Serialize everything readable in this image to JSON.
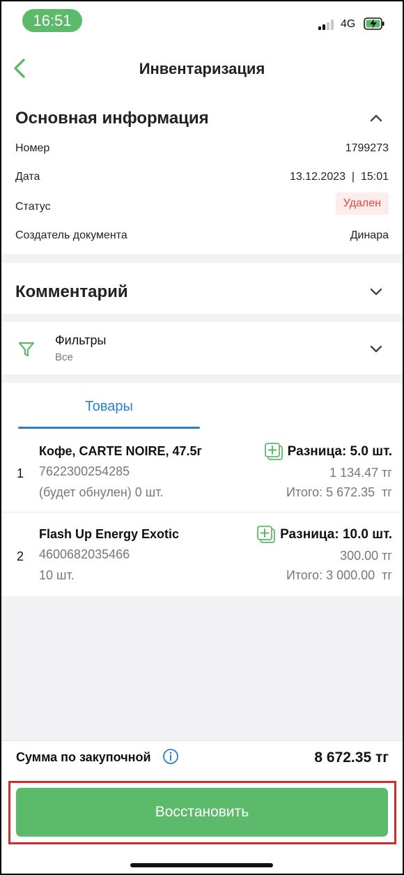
{
  "status_bar": {
    "time": "16:51",
    "network": "4G"
  },
  "nav": {
    "back_icon": "chevron-left-icon",
    "title": "Инвентаризация"
  },
  "main_info": {
    "title": "Основная информация",
    "collapse_icon": "chevron-up-icon",
    "rows": {
      "number": {
        "label": "Номер",
        "value": "1799273"
      },
      "date": {
        "label": "Дата",
        "value": "13.12.2023  |  15:01"
      },
      "status": {
        "label": "Статус",
        "value": "Удален"
      },
      "creator": {
        "label": "Создатель документа",
        "value": "Динара"
      }
    }
  },
  "comment": {
    "title": "Комментарий",
    "expand_icon": "chevron-down-icon"
  },
  "filters": {
    "icon": "filter-icon",
    "title": "Фильтры",
    "value": "Все",
    "expand_icon": "chevron-down-icon"
  },
  "tabs": {
    "goods": "Товары"
  },
  "items": [
    {
      "index": "1",
      "name": "Кофе, CARTE NOIRE, 47.5г",
      "barcode": "7622300254285",
      "quantity": "(будет обнулен) 0 шт.",
      "difference": "Разница: 5.0 шт.",
      "price": "1 134.47 тг",
      "total": "Итого: 5 672.35  тг"
    },
    {
      "index": "2",
      "name": "Flash Up Energy Exotic",
      "barcode": "4600682035466",
      "quantity": "10 шт.",
      "difference": "Разница: 10.0 шт.",
      "price": "300.00 тг",
      "total": "Итого: 3 000.00  тг"
    }
  ],
  "footer": {
    "sum_label": "Сумма по закупочной",
    "sum_info_icon": "info-icon",
    "sum_value": "8 672.35 тг",
    "restore_button": "Восстановить"
  },
  "colors": {
    "accent_green": "#5cbb6b",
    "tab_blue": "#2a7fd4",
    "status_red": "#e0483c",
    "highlight_red": "#d32c2c"
  }
}
